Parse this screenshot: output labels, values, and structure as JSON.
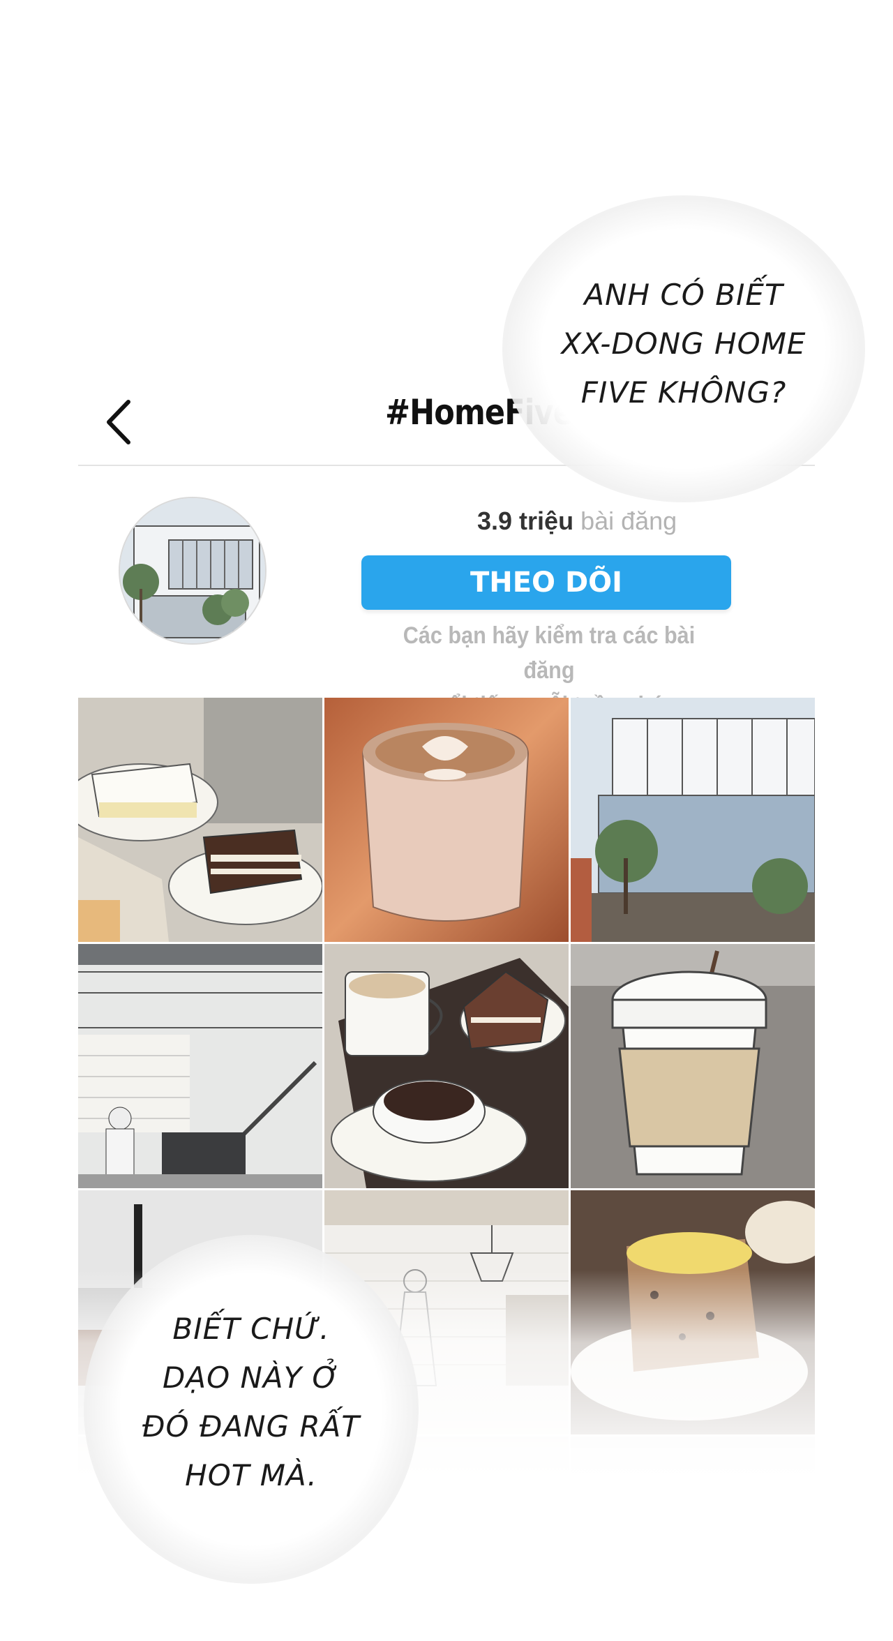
{
  "header": {
    "title": "#HomeFive",
    "back_icon": "chevron-left-icon"
  },
  "profile": {
    "post_count": "3.9 triệu",
    "post_label": "bài đăng",
    "follow_label": "THEO DÕI",
    "description_line1": "Các bạn hãy kiểm tra các bài đăng",
    "description_line2": "nổi tiếng mỗi tuần nhé",
    "accent_color": "#2aa5ec"
  },
  "dialogue": {
    "top": [
      "ANH CÓ BIẾT",
      "XX-DONG HOME",
      "FIVE KHÔNG?"
    ],
    "bottom": [
      "BIẾT CHỨ.",
      "DẠO NÀY Ở",
      "ĐÓ ĐANG RẤT",
      "HOT MÀ."
    ]
  },
  "posts": [
    {
      "subject": "cake-slices"
    },
    {
      "subject": "latte-cup"
    },
    {
      "subject": "building-exterior"
    },
    {
      "subject": "cafe-interior-stairs"
    },
    {
      "subject": "coffee-and-cake"
    },
    {
      "subject": "takeaway-coffee"
    },
    {
      "subject": "iced-drink"
    },
    {
      "subject": "chandelier-room"
    },
    {
      "subject": "pound-cake"
    }
  ]
}
